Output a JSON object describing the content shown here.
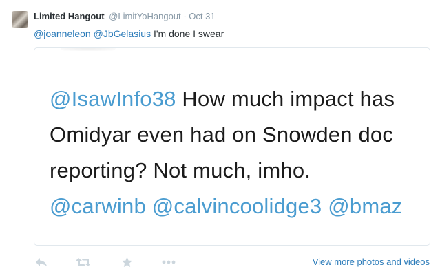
{
  "tweet": {
    "author_name": "Limited Hangout",
    "author_handle": "@LimitYoHangout",
    "separator": "·",
    "time": "Oct 31",
    "mention_1": "@joanneleon",
    "mention_2": "@JbGelasius",
    "text": " I'm done I swear"
  },
  "media": {
    "mention_a": "@IsawInfo38",
    "text_a": " How much impact has Omidyar even had on Snowden doc reporting? Not much, imho. ",
    "mention_b": "@carwinb",
    "mention_c": "@calvincoolidge3",
    "mention_d": "@bmaz"
  },
  "actions": {
    "reply_icon": "reply-icon",
    "retweet_icon": "retweet-icon",
    "favorite_icon": "star-icon",
    "more_icon": "more-dots-icon",
    "view_more": "View more photos and videos",
    "icon_color": "#ccd6dd",
    "link_color": "#2b7bb9"
  }
}
